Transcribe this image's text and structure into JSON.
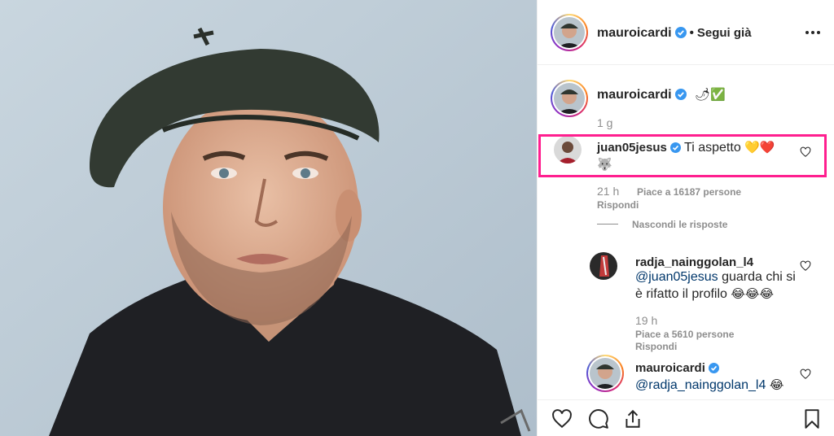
{
  "header": {
    "username": "mauroicardi",
    "separator": "•",
    "follow_label": "Segui già"
  },
  "caption": {
    "username": "mauroicardi",
    "emojis": "🌶✅",
    "time": "1 g"
  },
  "comments": [
    {
      "username": "juan05jesus",
      "text": "Ti aspetto",
      "emojis": "💛❤️",
      "emoji_line2": "🐺",
      "time": "21 h",
      "likes": "Piace a 16187 persone",
      "reply": "Rispondi",
      "hide_replies": "Nascondi le risposte"
    }
  ],
  "replies": [
    {
      "username": "radja_nainggolan_l4",
      "mention": "@juan05jesus",
      "text_line1": " guarda chi si",
      "text_line2": "è rifatto il profilo",
      "emojis": "😂😂😂",
      "time": "19 h",
      "likes": "Piace a 5610 persone",
      "reply": "Rispondi"
    },
    {
      "username": "mauroicardi",
      "mention": "@radja_nainggolan_l4",
      "emojis": "😂"
    }
  ],
  "icons": {
    "like": "heart-icon",
    "comment": "comment-icon",
    "share": "share-icon",
    "save": "bookmark-icon",
    "more": "more-options-icon",
    "verified": "verified-badge-icon"
  },
  "colors": {
    "highlight": "#ff1f8f",
    "verified": "#3897f0",
    "mention": "#00376b",
    "muted": "#8e8e8e"
  }
}
